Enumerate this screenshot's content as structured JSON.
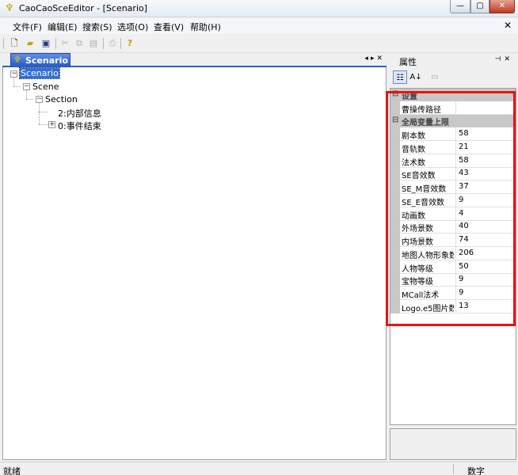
{
  "window": {
    "title": "CaoCaoSceEditor - [Scenario]",
    "close_glyph": "✕"
  },
  "menu": [
    "文件(F)",
    "编辑(E)",
    "搜索(S)",
    "选项(O)",
    "查看(V)",
    "帮助(H)"
  ],
  "toolbar_icons": [
    "new-file-icon",
    "open-folder-icon",
    "save-icon",
    "cut-icon",
    "copy-icon",
    "paste-icon",
    "print-icon",
    "help-icon"
  ],
  "document": {
    "tab_label": "Scenario",
    "tree": {
      "root": "Scenario",
      "scene": "Scene",
      "section": "Section",
      "item1": "2:内部信息",
      "item2": "0:事件结束"
    }
  },
  "properties": {
    "title": "属性",
    "category1": "设置",
    "path_name": "曹操传路径",
    "path_value": "",
    "category2": "全局变量上限",
    "rows": [
      {
        "name": "剧本数",
        "value": "58"
      },
      {
        "name": "音轨数",
        "value": "21"
      },
      {
        "name": "法术数",
        "value": "58"
      },
      {
        "name": "SE音效数",
        "value": "43"
      },
      {
        "name": "SE_M音效数",
        "value": "37"
      },
      {
        "name": "SE_E音效数",
        "value": "9"
      },
      {
        "name": "动画数",
        "value": "4"
      },
      {
        "name": "外场景数",
        "value": "40"
      },
      {
        "name": "内场景数",
        "value": "74"
      },
      {
        "name": "地图人物形象数",
        "value": "206"
      },
      {
        "name": "人物等级",
        "value": "50"
      },
      {
        "name": "宝物等级",
        "value": "9"
      },
      {
        "name": "MCall法术",
        "value": "9"
      },
      {
        "name": "Logo.e5图片数",
        "value": "13"
      }
    ]
  },
  "status": {
    "left": "就绪",
    "right": "数字"
  },
  "colors": {
    "selection": "#3070d8",
    "tab_active": "#2558c6",
    "highlight_box": "#ee1111"
  }
}
